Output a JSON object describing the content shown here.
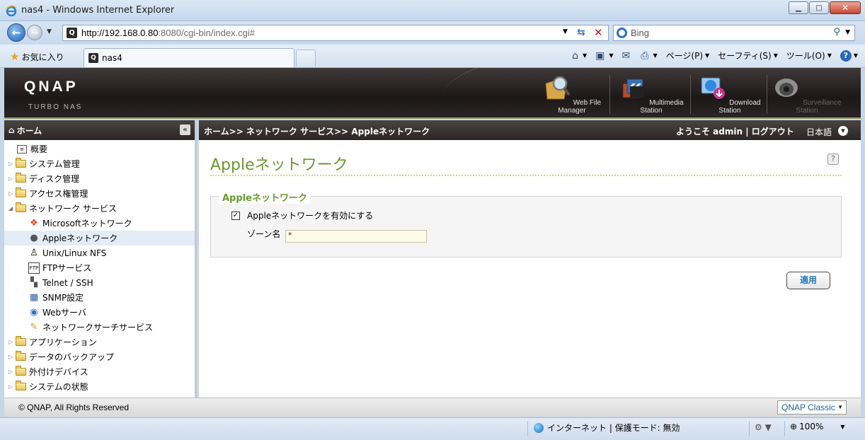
{
  "window": {
    "title": "nas4 - Windows Internet Explorer"
  },
  "address": {
    "url_host": "http://192.168.0.80",
    "url_rest": ":8080/cgi-bin/index.cgi#",
    "search_placeholder": "Bing"
  },
  "favorites": {
    "label": "お気に入り"
  },
  "tab": {
    "label": "nas4"
  },
  "commands": {
    "page": "ページ(P)",
    "safety": "セーフティ(S)",
    "tools": "ツール(O)"
  },
  "qnap": {
    "logo": "QNAP",
    "subtitle": "TURBO NAS",
    "apps": [
      {
        "label": "Web File Manager",
        "icon": "magnifier-folder-icon"
      },
      {
        "label": "Multimedia Station",
        "icon": "multimedia-icon"
      },
      {
        "label": "Download Station",
        "icon": "download-globe-icon"
      },
      {
        "label": "Surveillance Station",
        "icon": "camera-icon"
      }
    ]
  },
  "sidebar": {
    "header": "ホーム",
    "items": [
      {
        "label": "概要"
      },
      {
        "label": "システム管理"
      },
      {
        "label": "ディスク管理"
      },
      {
        "label": "アクセス権管理"
      },
      {
        "label": "ネットワーク サービス"
      },
      {
        "label": "Microsoftネットワーク"
      },
      {
        "label": "Appleネットワーク"
      },
      {
        "label": "Unix/Linux NFS"
      },
      {
        "label": "FTPサービス"
      },
      {
        "label": "Telnet / SSH"
      },
      {
        "label": "SNMP設定"
      },
      {
        "label": "Webサーバ"
      },
      {
        "label": "ネットワークサーチサービス"
      },
      {
        "label": "アプリケーション"
      },
      {
        "label": "データのバックアップ"
      },
      {
        "label": "外付けデバイス"
      },
      {
        "label": "システムの状態"
      }
    ]
  },
  "main": {
    "breadcrumb": "ホーム>> ネットワーク サービス>> Appleネットワーク",
    "welcome": "ようこそ admin | ログアウト",
    "language": "日本語",
    "page_title": "Appleネットワーク",
    "section_legend": "Appleネットワーク",
    "enable_label": "Appleネットワークを有効にする",
    "enable_checked": true,
    "zone_label": "ゾーン名",
    "zone_value": "*",
    "apply_label": "適用"
  },
  "footer": {
    "copyright": "© QNAP, All Rights Reserved",
    "skin": "QNAP Classic"
  },
  "statusbar": {
    "zone": "インターネット | 保護モード: 無効",
    "zoom": "100%"
  }
}
